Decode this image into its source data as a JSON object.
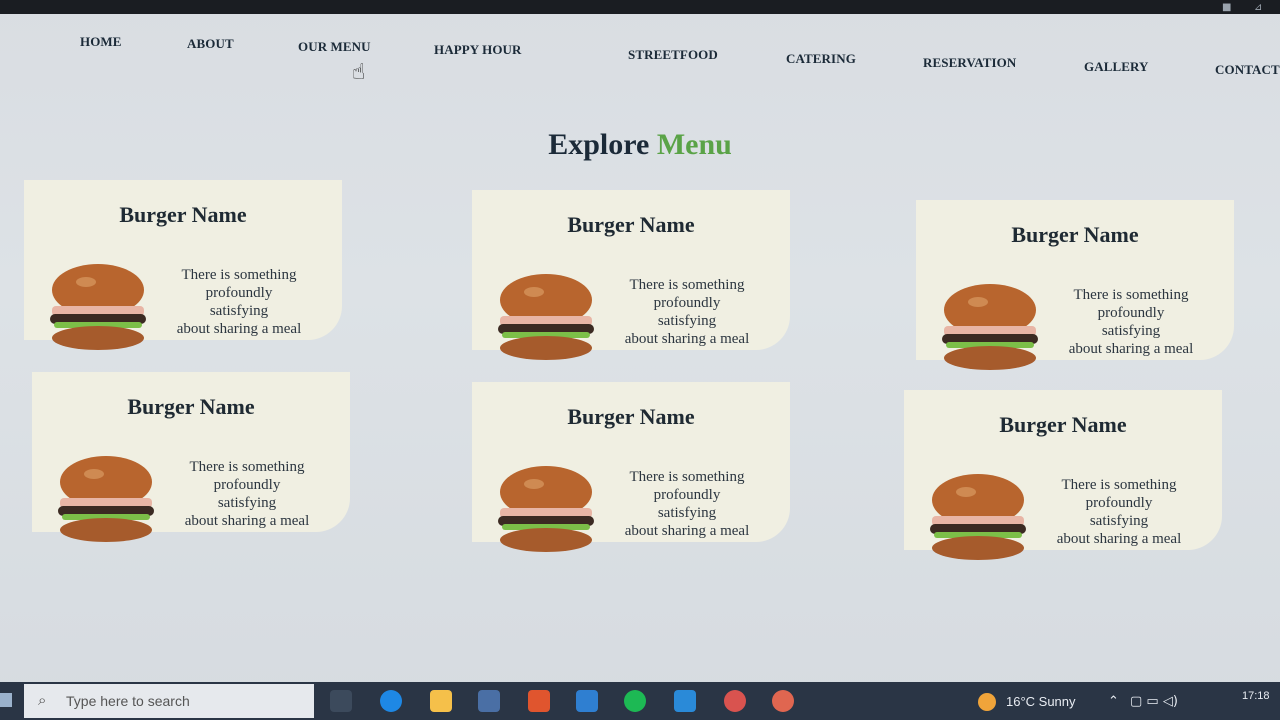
{
  "nav": {
    "items": [
      "HOME",
      "ABOUT",
      "OUR MENU",
      "HAPPY HOUR",
      "STREETFOOD",
      "CATERING",
      "RESERVATION",
      "GALLERY",
      "CONTACT"
    ]
  },
  "section": {
    "title_part1": "Explore",
    "title_part2": "Menu"
  },
  "cards": [
    {
      "name": "Burger Name",
      "desc_lines": [
        "There is something",
        "profoundly",
        "satisfying",
        "about sharing a meal"
      ]
    },
    {
      "name": "Burger Name",
      "desc_lines": [
        "There is something",
        "profoundly",
        "satisfying",
        "about sharing a meal"
      ]
    },
    {
      "name": "Burger Name",
      "desc_lines": [
        "There is something",
        "profoundly",
        "satisfying",
        "about sharing a meal"
      ]
    },
    {
      "name": "Burger Name",
      "desc_lines": [
        "There is something",
        "profoundly",
        "satisfying",
        "about sharing a meal"
      ]
    },
    {
      "name": "Burger Name",
      "desc_lines": [
        "There is something",
        "profoundly",
        "satisfying",
        "about sharing a meal"
      ]
    },
    {
      "name": "Burger Name",
      "desc_lines": [
        "There is something",
        "profoundly",
        "satisfying",
        "about sharing a meal"
      ]
    }
  ],
  "taskbar": {
    "search_placeholder": "Type here to search",
    "weather": "16°C  Sunny",
    "time": "17:18"
  },
  "colors": {
    "accent": "#5aa347",
    "card_bg": "#f0efe2",
    "taskbar": "#2a3545"
  }
}
